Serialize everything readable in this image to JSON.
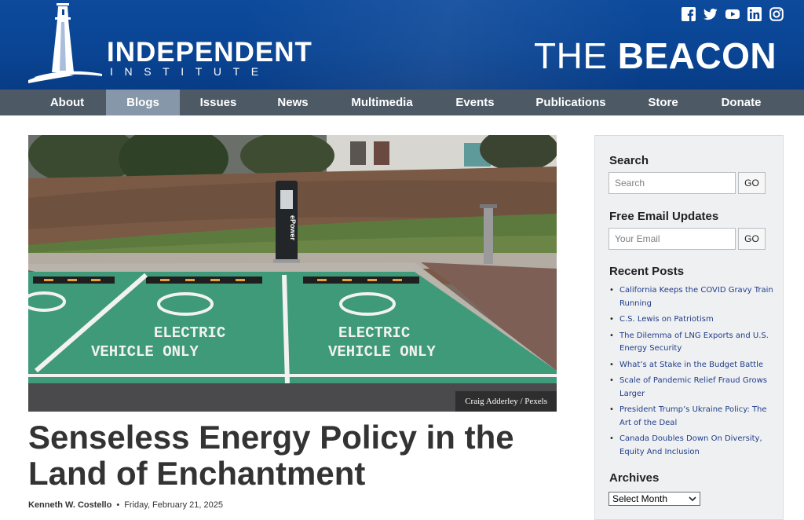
{
  "header": {
    "brand_main": "INDEPENDENT",
    "brand_sub": "INSTITUTE",
    "beacon_the": "THE",
    "beacon_name": "BEACON",
    "social_icons": [
      "facebook-icon",
      "twitter-icon",
      "youtube-icon",
      "linkedin-icon",
      "instagram-icon"
    ]
  },
  "nav": {
    "items": [
      "About",
      "Blogs",
      "Issues",
      "News",
      "Multimedia",
      "Events",
      "Publications",
      "Store",
      "Donate"
    ],
    "active": "Blogs"
  },
  "article": {
    "image_credit": "Craig Adderley / Pexels",
    "image_text": {
      "charger_brand": "ePower",
      "left_bay_line1": "ELECTRIC",
      "left_bay_line2": "VEHICLE ONLY",
      "right_bay_line1": "ELECTRIC",
      "right_bay_line2": "VEHICLE ONLY"
    },
    "title_line1": "Senseless Energy Policy in the",
    "title_line2": "Land of Enchantment",
    "author": "Kenneth W. Costello",
    "separator": "•",
    "date": "Friday, February 21, 2025"
  },
  "sidebar": {
    "search_heading": "Search",
    "search_placeholder": "Search",
    "go_label": "GO",
    "email_heading": "Free Email Updates",
    "email_placeholder": "Your Email",
    "recent_heading": "Recent Posts",
    "recent_posts": [
      "California Keeps the COVID Gravy Train Running",
      "C.S. Lewis on Patriotism",
      "The Dilemma of LNG Exports and U.S. Energy Security",
      "What’s at Stake in the Budget Battle",
      "Scale of Pandemic Relief Fraud Grows Larger",
      "President Trump’s Ukraine Policy: The Art of the Deal",
      "Canada Doubles Down On Diversity, Equity And Inclusion"
    ],
    "archives_heading": "Archives",
    "archives_select": "Select Month"
  },
  "colors": {
    "header_blue": "#0a4594",
    "nav_gray": "#4d5a66",
    "nav_active": "#8597a8",
    "link_blue": "#1f3d8a",
    "parking_green": "#3f9a7a"
  }
}
